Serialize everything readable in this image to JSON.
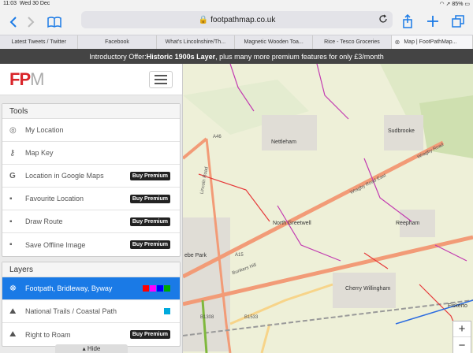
{
  "status": {
    "time": "11:03",
    "date": "Wed 30 Dec",
    "battery": "85%"
  },
  "browser": {
    "url": "footpathmap.co.uk"
  },
  "tabs": [
    {
      "label": "Latest Tweets / Twitter"
    },
    {
      "label": "Facebook"
    },
    {
      "label": "What's Lincolnshire/Th..."
    },
    {
      "label": "Magnetic Wooden Toa..."
    },
    {
      "label": "Rice - Tesco Groceries"
    },
    {
      "label": "Map | FootPathMap..."
    }
  ],
  "promo": {
    "prefix": "Introductory Offer: ",
    "highlight": "Historic 1900s Layer",
    "suffix": ", plus many more premium features for only £3/month"
  },
  "logo": {
    "fp": "FP",
    "m": "M"
  },
  "tools": {
    "heading": "Tools",
    "items": [
      {
        "label": "My Location",
        "icon": "target-icon",
        "badge": ""
      },
      {
        "label": "Map Key",
        "icon": "key-icon",
        "badge": ""
      },
      {
        "label": "Location in Google Maps",
        "icon": "google-icon",
        "badge": "Buy Premium"
      },
      {
        "label": "Favourite Location",
        "icon": "save-icon",
        "badge": "Buy Premium"
      },
      {
        "label": "Draw Route",
        "icon": "save-icon",
        "badge": "Buy Premium"
      },
      {
        "label": "Save Offline Image",
        "icon": "save-icon",
        "badge": "Buy Premium"
      }
    ]
  },
  "layers": {
    "heading": "Layers",
    "items": [
      {
        "label": "Footpath, Bridleway, Byway",
        "icon": "walker-icon"
      },
      {
        "label": "National Trails / Coastal Path",
        "icon": "hiker-icon"
      },
      {
        "label": "Right to Roam",
        "icon": "hiker-icon"
      }
    ],
    "footpath_colors": [
      "#ff0000",
      "#ff00ff",
      "#0000ff",
      "#00aa00"
    ],
    "trail_color": "#00aadd"
  },
  "hide_label": "Hide",
  "map": {
    "labels": {
      "nettleham": "Nettleham",
      "sudbrooke": "Sudbrooke",
      "north_greetwell": "North Greetwell",
      "reepham": "Reepham",
      "cherry_willingham": "Cherry Willingham",
      "ebe_park": "ebe Park",
      "fiskerton": "Fiskerto",
      "wragby_road_east": "Wragby Road East",
      "wragby_road": "Wragby Road",
      "lincoln_road": "Lincoln Road",
      "a46": "A46",
      "a15": "A15",
      "b1308": "B1308",
      "b1533": "B1533",
      "bunkers_hill": "Bunkers Hill"
    },
    "zoom_in": "+",
    "zoom_out": "−"
  }
}
